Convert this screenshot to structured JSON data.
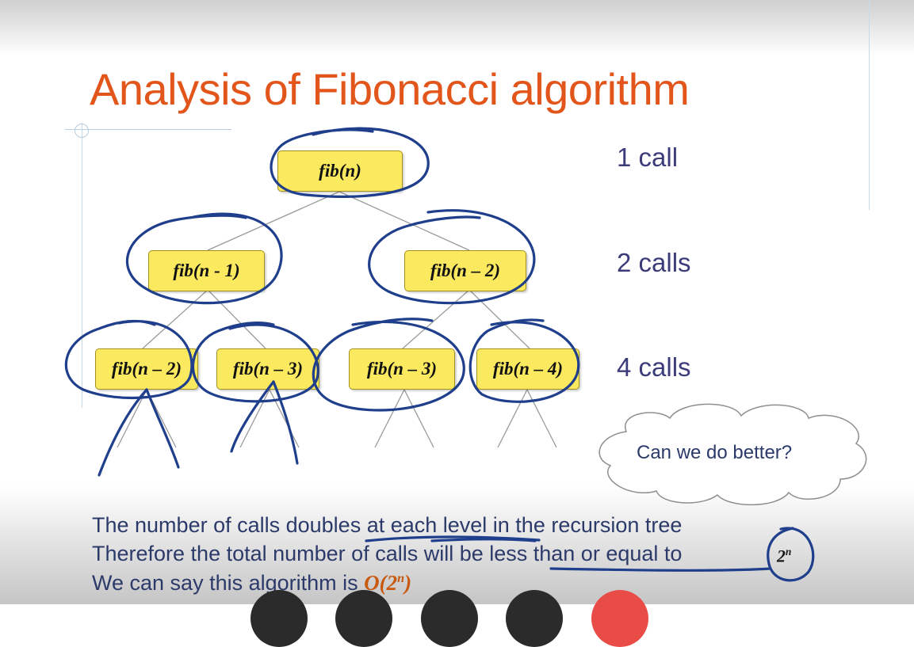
{
  "slide": {
    "title": "Analysis of Fibonacci algorithm"
  },
  "tree": {
    "root": "fib(n)",
    "level1": [
      "fib(n - 1)",
      "fib(n – 2)"
    ],
    "level2": [
      "fib(n – 2)",
      "fib(n – 3)",
      "fib(n – 3)",
      "fib(n – 4)"
    ]
  },
  "level_labels": [
    "1 call",
    "2 calls",
    "4 calls"
  ],
  "cloud": {
    "text": "Can we do better?"
  },
  "body": {
    "line1": "The number of calls doubles at each level in the recursion tree",
    "line2": "Therefore the total number of calls will be less than or equal to",
    "line2_expr_base": "2",
    "line2_expr_exp": "n",
    "line3_prefix": "We can say this algorithm is",
    "line3_expr_open": "O(2",
    "line3_expr_exp": "n",
    "line3_expr_close": ")"
  },
  "colors": {
    "title": "#e2561c",
    "node_fill": "#fbe95f",
    "text": "#2c3a6a",
    "ink": "#1f3f8c",
    "big_o": "#c8590f"
  },
  "player_controls": [
    "control-button",
    "control-button",
    "control-button",
    "control-button",
    "record-button"
  ]
}
